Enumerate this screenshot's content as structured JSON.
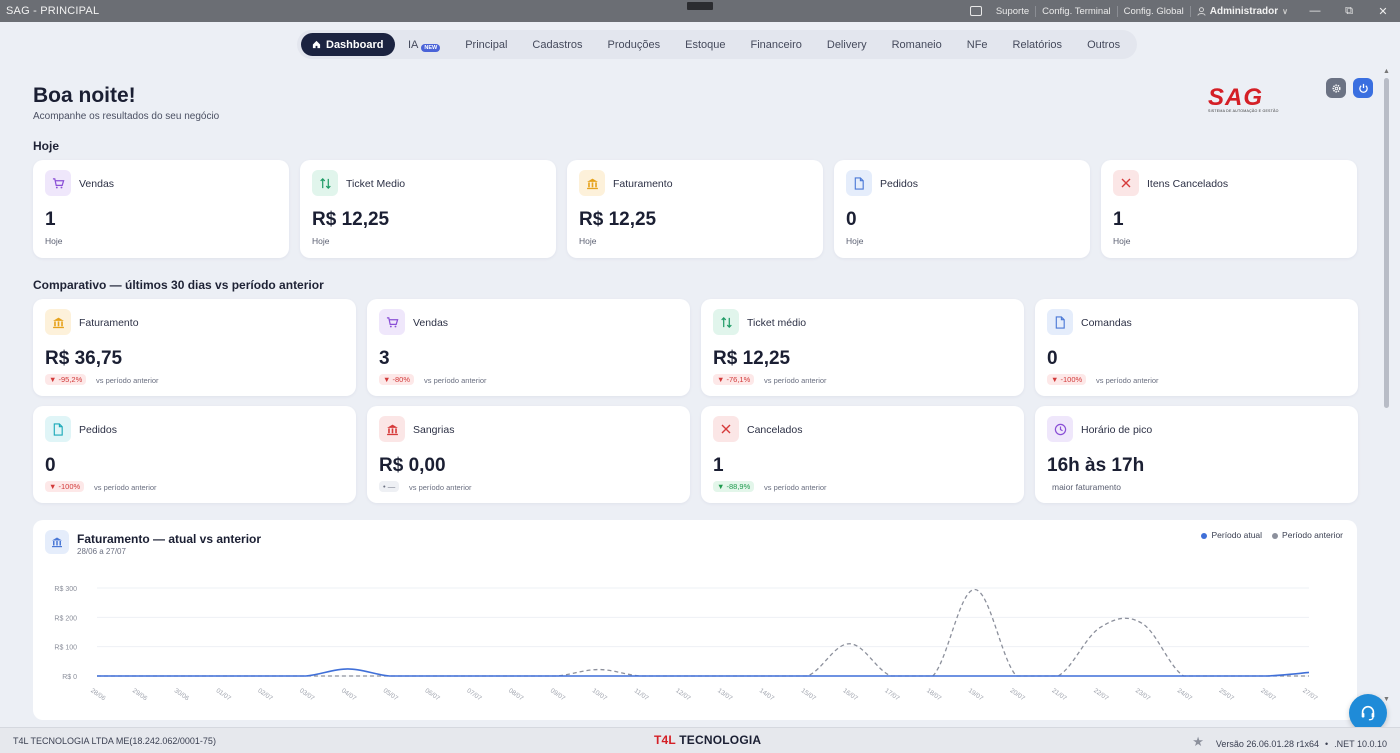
{
  "window": {
    "title": "SAG - PRINCIPAL",
    "links": [
      "Suporte",
      "Config. Terminal",
      "Config. Global"
    ],
    "user": "Administrador",
    "controls": [
      "—",
      "⧉",
      "✕"
    ]
  },
  "nav": {
    "items": [
      {
        "label": "Dashboard",
        "active": true
      },
      {
        "label": "IA",
        "badge": "NEW"
      },
      {
        "label": "Principal"
      },
      {
        "label": "Cadastros"
      },
      {
        "label": "Produções"
      },
      {
        "label": "Estoque"
      },
      {
        "label": "Financeiro"
      },
      {
        "label": "Delivery"
      },
      {
        "label": "Romaneio"
      },
      {
        "label": "NFe"
      },
      {
        "label": "Relatórios"
      },
      {
        "label": "Outros"
      }
    ]
  },
  "header": {
    "greeting": "Boa noite!",
    "subtitle": "Acompanhe os resultados do seu negócio",
    "logo_text": "SAG",
    "logo_sub": "SISTEMA DE AUTOMAÇÃO E GESTÃO"
  },
  "today": {
    "label": "Hoje",
    "cards": [
      {
        "title": "Vendas",
        "value": "1",
        "sub": "Hoje",
        "icon": "cart-icon",
        "color": "#8a4fd6",
        "bg": "#efe7fb"
      },
      {
        "title": "Ticket Medio",
        "value": "R$ 12,25",
        "sub": "Hoje",
        "icon": "arrows-icon",
        "color": "#1e9b65",
        "bg": "#e1f5ec"
      },
      {
        "title": "Faturamento",
        "value": "R$ 12,25",
        "sub": "Hoje",
        "icon": "bank-icon",
        "color": "#e6a21c",
        "bg": "#fdf1da"
      },
      {
        "title": "Pedidos",
        "value": "0",
        "sub": "Hoje",
        "icon": "document-icon",
        "color": "#4a78d6",
        "bg": "#e5edfb"
      },
      {
        "title": "Itens Cancelados",
        "value": "1",
        "sub": "Hoje",
        "icon": "x-icon",
        "color": "#d63a3a",
        "bg": "#fbe6e6"
      }
    ]
  },
  "comparison": {
    "label": "Comparativo — últimos 30 dias vs período anterior",
    "vs_label": "vs período anterior",
    "cards": [
      {
        "title": "Faturamento",
        "value": "R$ 36,75",
        "delta": "▼ -95,2%",
        "trend": "down",
        "icon": "bank-icon",
        "color": "#e6a21c",
        "bg": "#fdf1da"
      },
      {
        "title": "Vendas",
        "value": "3",
        "delta": "▼ -80%",
        "trend": "down",
        "icon": "cart-icon",
        "color": "#8a4fd6",
        "bg": "#efe7fb"
      },
      {
        "title": "Ticket médio",
        "value": "R$ 12,25",
        "delta": "▼ -76,1%",
        "trend": "down",
        "icon": "arrows-icon",
        "color": "#1e9b65",
        "bg": "#e1f5ec"
      },
      {
        "title": "Comandas",
        "value": "0",
        "delta": "▼ -100%",
        "trend": "down",
        "icon": "document-icon",
        "color": "#4a78d6",
        "bg": "#e5edfb"
      },
      {
        "title": "Pedidos",
        "value": "0",
        "delta": "▼ -100%",
        "trend": "down",
        "icon": "document-icon",
        "color": "#1aa9b8",
        "bg": "#e0f5f7"
      },
      {
        "title": "Sangrias",
        "value": "R$ 0,00",
        "delta": "• —",
        "trend": "flat",
        "icon": "bank-icon",
        "color": "#d63a3a",
        "bg": "#fbe6e6"
      },
      {
        "title": "Cancelados",
        "value": "1",
        "delta": "▼ -88,9%",
        "trend": "up",
        "icon": "x-icon",
        "color": "#d63a3a",
        "bg": "#fbe6e6"
      },
      {
        "title": "Horário de pico",
        "value": "16h às 17h",
        "sub": "maior faturamento",
        "icon": "clock-icon",
        "color": "#8a4fd6",
        "bg": "#efe7fb"
      }
    ]
  },
  "chart_data": {
    "type": "line",
    "title": "Faturamento — atual vs anterior",
    "subtitle": "28/06 a 27/07",
    "x": [
      "28/06",
      "29/06",
      "30/06",
      "01/07",
      "02/07",
      "03/07",
      "04/07",
      "05/07",
      "06/07",
      "07/07",
      "08/07",
      "09/07",
      "10/07",
      "11/07",
      "12/07",
      "13/07",
      "14/07",
      "15/07",
      "16/07",
      "17/07",
      "18/07",
      "19/07",
      "20/07",
      "21/07",
      "22/07",
      "23/07",
      "24/07",
      "25/07",
      "26/07",
      "27/07"
    ],
    "yticks": [
      "R$ 0",
      "R$ 100",
      "R$ 200",
      "R$ 300"
    ],
    "ylim": [
      0,
      300
    ],
    "legend_position": "top-right",
    "series": [
      {
        "name": "Período atual",
        "color": "#3f6fd8",
        "dashed": false,
        "values": [
          0,
          0,
          0,
          0,
          0,
          0,
          24,
          0,
          0,
          0,
          0,
          0,
          0,
          0,
          0,
          0,
          0,
          0,
          0,
          0,
          0,
          0,
          0,
          0,
          0,
          0,
          0,
          0,
          0,
          12
        ]
      },
      {
        "name": "Período anterior",
        "color": "#8c909c",
        "dashed": true,
        "values": [
          0,
          0,
          0,
          0,
          0,
          0,
          0,
          0,
          0,
          0,
          0,
          0,
          22,
          0,
          0,
          0,
          0,
          0,
          110,
          0,
          0,
          295,
          0,
          0,
          165,
          180,
          0,
          0,
          0,
          0
        ]
      }
    ]
  },
  "footer": {
    "company": "T4L TECNOLOGIA LTDA ME(18.242.062/0001-75)",
    "brand_t": "T4L",
    "brand_rest": " TECNOLOGIA",
    "version": "Versão 26.06.01.28 r1x64",
    "sep": "•",
    "runtime": ".NET 10.0.10"
  }
}
